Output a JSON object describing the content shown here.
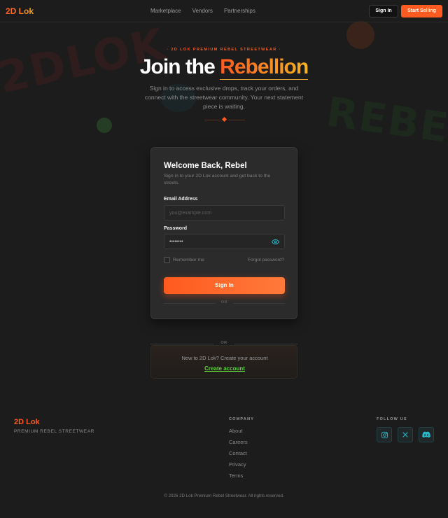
{
  "header": {
    "logo": "2D Lok",
    "nav": [
      "Marketplace",
      "Vendors",
      "Partnerships"
    ],
    "sign_in": "Sign In",
    "start_selling": "Start Selling"
  },
  "background": {
    "graffiti_left": "2DLOK",
    "graffiti_right": "REBEL"
  },
  "hero": {
    "eyebrow": "· 2D LOK PREMIUM REBEL STREETWEAR ·",
    "title_prefix": "Join the",
    "title_accent": "Rebellion",
    "subtitle": "Sign in to access exclusive drops, track your orders, and connect with the streetwear community. Your next statement piece is waiting."
  },
  "login": {
    "title": "Welcome Back, Rebel",
    "subtitle": "Sign in to your 2D Lok account and get back to the streets.",
    "email_label": "Email Address",
    "email_placeholder": "you@example.com",
    "password_label": "Password",
    "password_value": "••••••••",
    "remember_label": "Remember me",
    "forgot_label": "Forgot password?",
    "submit_label": "Sign In",
    "or_label": "OR"
  },
  "signup": {
    "or_label": "OR",
    "prompt": "New to 2D Lok? Create your account",
    "link": "Create account"
  },
  "footer": {
    "logo": "2D Lok",
    "tagline": "PREMIUM REBEL STREETWEAR",
    "company_title": "COMPANY",
    "company_links": [
      "About",
      "Careers",
      "Contact",
      "Privacy",
      "Terms"
    ],
    "follow_title": "FOLLOW US",
    "socials": [
      "instagram-icon",
      "x-icon",
      "discord-icon"
    ],
    "copyright": "© 2026 2D Lok Premium Rebel Streetwear. All rights reserved."
  },
  "colors": {
    "accent": "#ff5a1f",
    "accent_gold": "#f5a623",
    "link_green": "#5fd13b",
    "social_teal": "#2ab8c8"
  }
}
